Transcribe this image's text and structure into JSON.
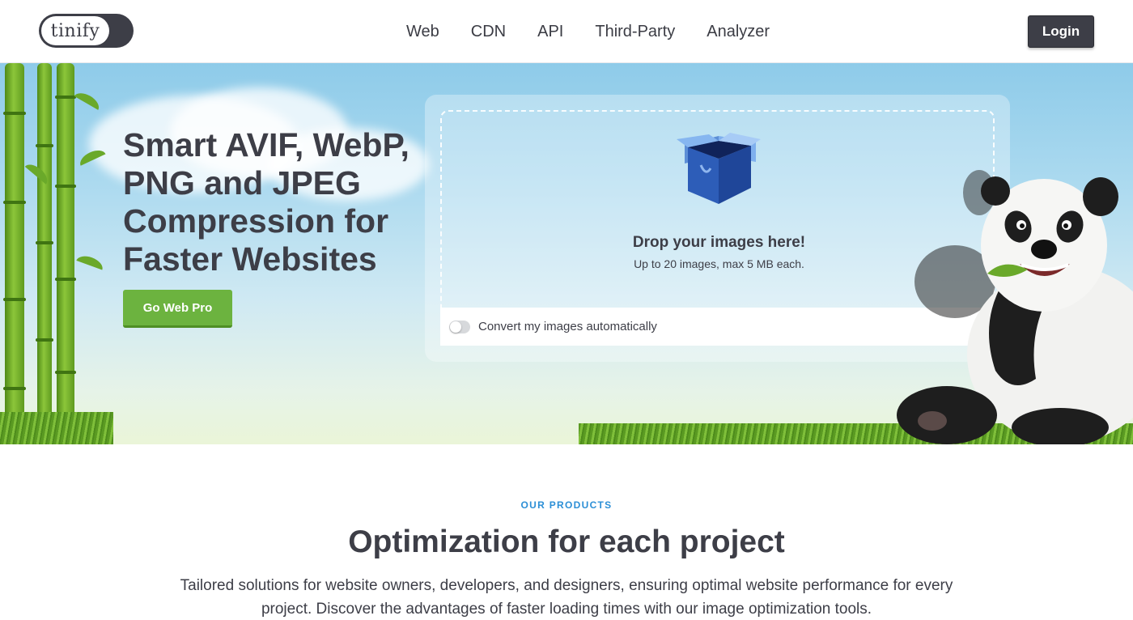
{
  "brand": {
    "logo_text": "tinify"
  },
  "nav": {
    "items": [
      "Web",
      "CDN",
      "API",
      "Third-Party",
      "Analyzer"
    ]
  },
  "header": {
    "login_label": "Login"
  },
  "hero": {
    "headline": "Smart AVIF, WebP, PNG and JPEG Compression for Faster Websites",
    "cta_label": "Go Web Pro",
    "dropzone": {
      "title": "Drop your images here!",
      "subtitle": "Up to 20 images, max 5 MB each.",
      "convert_label": "Convert my images automatically",
      "convert_enabled": false
    }
  },
  "products": {
    "eyebrow": "OUR PRODUCTS",
    "title": "Optimization for each project",
    "description": "Tailored solutions for website owners, developers, and designers, ensuring optimal website performance for every project. Discover the advantages of faster loading times with our image optimization tools."
  },
  "colors": {
    "dark": "#3d3e47",
    "accent_green": "#6cb33f",
    "accent_blue": "#2c8fd6",
    "sky": "#8ecbe9"
  },
  "icons": [
    "open-box-icon",
    "toggle-switch-icon"
  ]
}
